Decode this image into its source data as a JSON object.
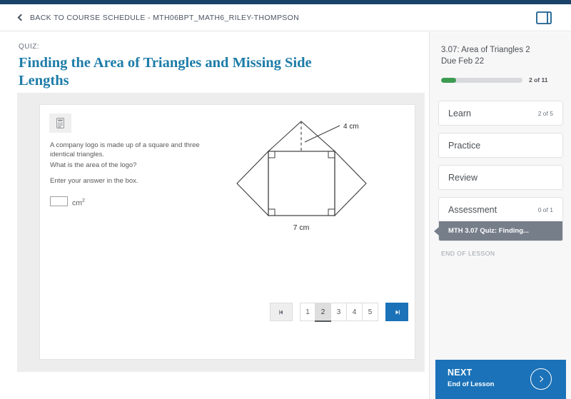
{
  "header": {
    "back_label": "BACK TO COURSE SCHEDULE - MTH06BPT_MATH6_RILEY-THOMPSON",
    "back_icon": "chevron-left-icon",
    "panel_toggle_icon": "panel-toggle-icon"
  },
  "main": {
    "quiz_label": "QUIZ:",
    "quiz_title": "Finding the Area of Triangles and Missing Side Lengths",
    "calculator_icon": "calculator-icon",
    "question": {
      "line1": "A company logo is made up of a square and three identical triangles.",
      "line2": "What is the area of the logo?",
      "line3": "Enter your answer in the box.",
      "answer_value": "",
      "answer_unit": "cm",
      "answer_unit_exponent": "2"
    },
    "figure": {
      "height_label": "4 cm",
      "base_label": "7 cm",
      "description": "square-with-three-triangles"
    },
    "pagination": {
      "prev_icon": "prev-arrow-icon",
      "next_icon": "next-arrow-icon",
      "pages": [
        "1",
        "2",
        "3",
        "4",
        "5"
      ],
      "active_index": 1
    }
  },
  "sidebar": {
    "lesson_title": "3.07: Area of Triangles 2",
    "due_label": "Due Feb 22",
    "progress": {
      "count_label": "2 of 11",
      "percent": 18
    },
    "items": [
      {
        "label": "Learn",
        "count": "2 of 5"
      },
      {
        "label": "Practice",
        "count": ""
      },
      {
        "label": "Review",
        "count": ""
      },
      {
        "label": "Assessment",
        "count": "0 of 1",
        "sub_label": "MTH 3.07 Quiz: Finding..."
      }
    ],
    "end_of_lesson": "END OF LESSON",
    "next_button": {
      "title": "NEXT",
      "subtitle": "End of Lesson",
      "icon": "chevron-right-icon"
    }
  },
  "colors": {
    "navy": "#1b4268",
    "title_blue": "#1d7ca8",
    "accent_purple": "#a862c6",
    "progress_green": "#3d9c52",
    "primary_blue": "#1b72b8",
    "selected_gray": "#767e8a"
  }
}
